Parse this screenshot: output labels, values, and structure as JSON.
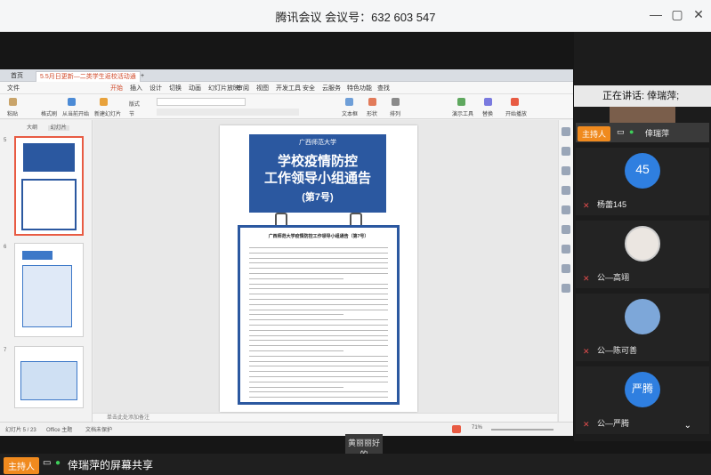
{
  "window": {
    "title": "腾讯会议 会议号：632 603 547",
    "buttons": [
      "—",
      "▢",
      "✕"
    ]
  },
  "wps": {
    "tabs": [
      "首页",
      "5.5月日更新—二类学生返校活动通",
      "+"
    ],
    "menu": [
      "文件",
      "开始",
      "插入",
      "设计",
      "切换",
      "动画",
      "幻灯片放映",
      "审阅",
      "视图",
      "开发工具",
      "安全",
      "云服务",
      "特色功能",
      "查找"
    ],
    "ribbon": [
      "粘贴",
      "格式刷",
      "从当前开始",
      "新建幻灯片",
      "版式",
      "节",
      "文本框",
      "形状",
      "排列",
      "演示工具",
      "替换",
      "开始播放"
    ],
    "sidebar_tabs": [
      "大纲",
      "幻灯片"
    ],
    "thumb_numbers": [
      "5",
      "6",
      "7"
    ],
    "notes_placeholder": "单击此处添加备注",
    "status": {
      "slide": "幻灯片 5 / 23",
      "theme": "Office 主题",
      "protect": "文档未保护",
      "zoom": "71%"
    }
  },
  "slide": {
    "logo": "广西师范大学",
    "title_line1": "学校疫情防控",
    "title_line2": "工作领导小组通告",
    "title_line3": "(第7号)",
    "doc_heading": "广西师范大学疫情防控工作领导小组通告（第7号）"
  },
  "meeting": {
    "speaking_label": "正在讲话: 倖瑞萍;",
    "host_badge": "主持人",
    "participants": [
      {
        "name": "倖瑞萍",
        "host": true,
        "avatar_text": "",
        "avatar_color": "#6b5a4a"
      },
      {
        "name": "杨蕾145",
        "host": false,
        "avatar_text": "45",
        "avatar_color": "#2f7fe0"
      },
      {
        "name": "公—高翊",
        "host": false,
        "avatar_text": "",
        "avatar_color": "#e8e4e0"
      },
      {
        "name": "公—陈可善",
        "host": false,
        "avatar_text": "",
        "avatar_color": "#7da7d9"
      },
      {
        "name": "公—严腾",
        "host": false,
        "avatar_text": "严腾",
        "avatar_color": "#2f7fe0"
      }
    ],
    "bottom_host": "主持人",
    "share_label": "倖瑞萍的屏幕共享",
    "caption": "黄丽丽好的"
  },
  "colors": {
    "banner_blue": "#2b58a0",
    "host_orange": "#f08a1e",
    "avatar_blue": "#2f7fe0",
    "selection_red": "#e85b43"
  }
}
